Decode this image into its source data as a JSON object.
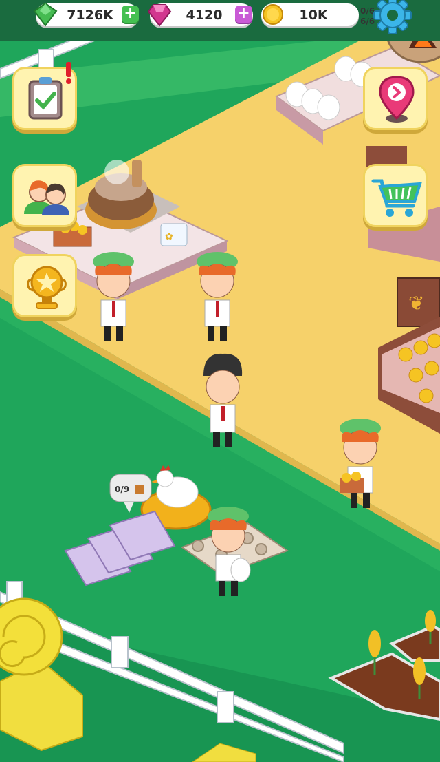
{
  "hud": {
    "cash": {
      "value": "7126K",
      "icon": "cash-icon",
      "add": "+"
    },
    "gems": {
      "value": "4120",
      "icon": "gem-icon",
      "add": "+"
    },
    "coins": {
      "value": "10K",
      "icon": "coin-icon"
    },
    "counter_top": "0/6",
    "counter_bottom": "6/6",
    "settings_icon": "gear-icon"
  },
  "side_buttons": {
    "left": [
      "clipboard-tasks-icon",
      "staff-icon",
      "trophy-icon"
    ],
    "right": [
      "map-pin-icon",
      "shopping-cart-icon"
    ]
  },
  "nest": {
    "capacity": "0/9"
  },
  "colors": {
    "grass": "#1fa65b",
    "path": "#f6d16a",
    "button_bg": "#fff3b0",
    "cash_green": "#44c051",
    "gem_purple": "#c95ad6"
  }
}
